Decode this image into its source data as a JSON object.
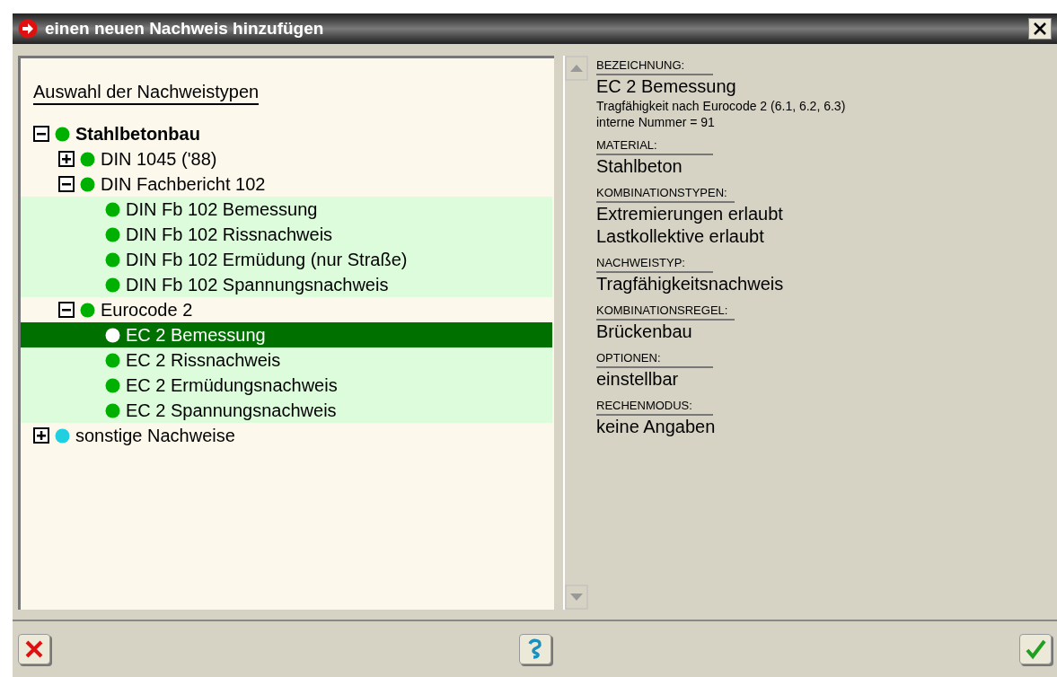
{
  "window": {
    "title": "einen neuen Nachweis hinzufügen"
  },
  "tree": {
    "heading": "Auswahl der Nachweistypen",
    "items": [
      {
        "label": "Stahlbetonbau",
        "kind": "group",
        "bold": true,
        "expanded": true,
        "color": "#00b000",
        "selected": false,
        "children": [
          {
            "label": "DIN 1045 ('88)",
            "kind": "group",
            "bold": false,
            "expanded": false,
            "color": "#00b000",
            "selected": false
          },
          {
            "label": "DIN Fachbericht 102",
            "kind": "group",
            "bold": false,
            "expanded": true,
            "color": "#00b000",
            "selected": false,
            "children": [
              {
                "label": "DIN Fb 102 Bemessung",
                "kind": "leaf",
                "color": "#00b000",
                "selected": false
              },
              {
                "label": "DIN Fb 102 Rissnachweis",
                "kind": "leaf",
                "color": "#00b000",
                "selected": false
              },
              {
                "label": "DIN Fb 102 Ermüdung (nur Straße)",
                "kind": "leaf",
                "color": "#00b000",
                "selected": false
              },
              {
                "label": "DIN Fb 102 Spannungsnachweis",
                "kind": "leaf",
                "color": "#00b000",
                "selected": false
              }
            ]
          },
          {
            "label": "Eurocode 2",
            "kind": "group",
            "bold": false,
            "expanded": true,
            "color": "#00b000",
            "selected": false,
            "children": [
              {
                "label": "EC 2 Bemessung",
                "kind": "leaf",
                "selected": true
              },
              {
                "label": "EC 2 Rissnachweis",
                "kind": "leaf",
                "color": "#00b000",
                "selected": false
              },
              {
                "label": "EC 2 Ermüdungsnachweis",
                "kind": "leaf",
                "color": "#00b000",
                "selected": false
              },
              {
                "label": "EC 2 Spannungsnachweis",
                "kind": "leaf",
                "color": "#00b000",
                "selected": false
              }
            ]
          }
        ]
      },
      {
        "label": "sonstige Nachweise",
        "kind": "group",
        "bold": false,
        "expanded": false,
        "color": "#20d0e0",
        "selected": false
      }
    ]
  },
  "details": [
    {
      "label": "BEZEICHNUNG:",
      "lines": [
        "EC 2 Bemessung"
      ],
      "notes": [
        "Tragfähigkeit nach Eurocode 2 (6.1, 6.2, 6.3)",
        "interne Nummer = 91"
      ]
    },
    {
      "label": "MATERIAL:",
      "lines": [
        "Stahlbeton"
      ]
    },
    {
      "label": "KOMBINATIONSTYPEN:",
      "lines": [
        "Extremierungen erlaubt",
        "Lastkollektive erlaubt"
      ]
    },
    {
      "label": "NACHWEISTYP:",
      "lines": [
        "Tragfähigkeitsnachweis"
      ]
    },
    {
      "label": "KOMBINATIONSREGEL:",
      "lines": [
        "Brückenbau"
      ]
    },
    {
      "label": "OPTIONEN:",
      "lines": [
        "einstellbar"
      ]
    },
    {
      "label": "RECHENMODUS:",
      "lines": [
        "keine Angaben"
      ]
    }
  ]
}
